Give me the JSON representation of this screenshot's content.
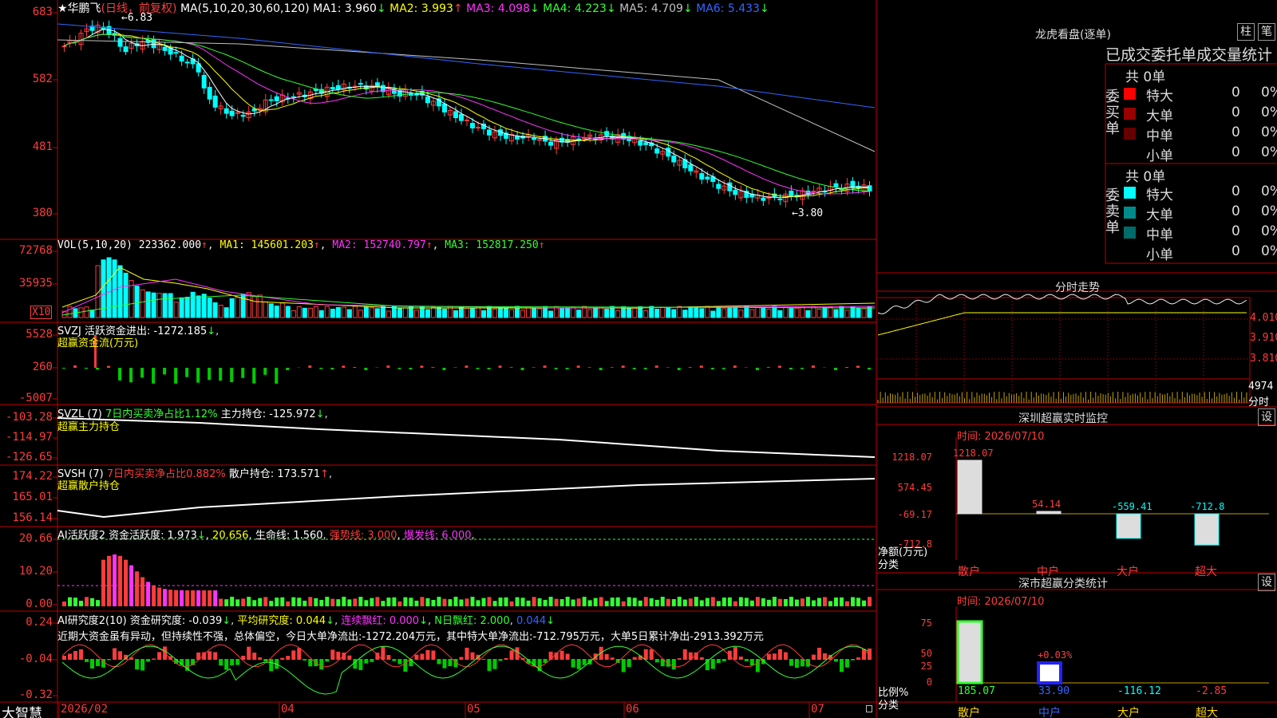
{
  "main_chart": {
    "title": "★华鹏飞",
    "period": "(日线，前复权)",
    "ma_label": "MA(5,10,20,30,60,120)",
    "ma_values": [
      {
        "label": "MA1: 3.960",
        "arrow": "↓",
        "color": "#ffffff"
      },
      {
        "label": "MA2: 3.993",
        "arrow": "↑",
        "color": "#ffff00"
      },
      {
        "label": "MA3: 4.098",
        "arrow": "↓",
        "color": "#ff33ff"
      },
      {
        "label": "MA4: 4.223",
        "arrow": "↓",
        "color": "#33ff33"
      },
      {
        "label": "MA5: 4.709",
        "arrow": "↓",
        "color": "#c0c0c0"
      },
      {
        "label": "MA6: 5.433",
        "arrow": "↓",
        "color": "#3366ff"
      }
    ],
    "y_ticks": [
      "683",
      "582",
      "481",
      "380"
    ],
    "high_label": "6.83",
    "low_label": "3.80"
  },
  "vol_panel": {
    "label": "VOL(5,10,20)",
    "value": "223362.000",
    "ma1": "MA1: 145601.203",
    "ma2": "MA2: 152740.797",
    "ma3": "MA3: 152817.250",
    "y_ticks": [
      "72768",
      "35935"
    ],
    "unit": "X10"
  },
  "svzj_panel": {
    "label": "SVZJ  活跃资金进出: -1272.185",
    "arrow": "↓",
    "subtitle": "超赢资金流(万元)",
    "y_ticks": [
      "5528",
      "260",
      "-5007"
    ]
  },
  "svzl_panel": {
    "label": "SVZL (7)",
    "ratio": "7日内买卖净占比1.12%",
    "value": "主力持仓: -125.972",
    "arrow": "↓",
    "subtitle": "超赢主力持仓",
    "y_ticks": [
      "-103.28",
      "-114.97",
      "-126.65"
    ]
  },
  "svsh_panel": {
    "label": "SVSH (7)",
    "ratio": "7日内买卖净占比0.882%",
    "value": "散户持仓: 173.571",
    "arrow": "↑",
    "subtitle": "超赢散户持仓",
    "y_ticks": [
      "174.22",
      "165.01",
      "156.14"
    ]
  },
  "ai_active_panel": {
    "label": "AI活跃度2",
    "activity": "资金活跃度: 1.973",
    "value2": "20.656",
    "life_line": "生命线: 1.560",
    "strong_line": "强势线: 3.000",
    "burst_line": "爆发线: 6.000",
    "y_ticks": [
      "20.66",
      "10.20",
      "0.00"
    ]
  },
  "ai_research_panel": {
    "label": "AI研究度2(10)",
    "research": "资金研究度: -0.039",
    "avg": "平均研究度: 0.044",
    "streak": "连续飘红: 0.000",
    "nday": "N日飘红: 2.000",
    "last": "0.044",
    "commentary": "近期大资金虽有异动，但持续性不强，总体偏空，今日大单净流出:-1272.204万元，其中特大单净流出:-712.795万元，大单5日累计净出-2913.392万元",
    "y_ticks": [
      "0.24",
      "-0.04",
      "-0.32"
    ]
  },
  "x_axis": {
    "brand": "大智慧",
    "labels": [
      "2026/02",
      "04",
      "05",
      "06",
      "07"
    ]
  },
  "dragon_tiger": {
    "title": "龙虎看盘(逐单)",
    "btn_zhu": "柱",
    "btn_bi": "笔",
    "header": "已成交委托单成交量统计",
    "buy_label": "委买单",
    "sell_label": "委卖单",
    "buy_total": "共 0单",
    "sell_total": "共 0单",
    "buy_rows": [
      {
        "name": "特大",
        "count": "0",
        "pct": "0%",
        "color": "#ff0000"
      },
      {
        "name": "大单",
        "count": "0",
        "pct": "0%",
        "color": "#990000"
      },
      {
        "name": "中单",
        "count": "0",
        "pct": "0%",
        "color": "#660000"
      },
      {
        "name": "小单",
        "count": "0",
        "pct": "0%",
        "color": ""
      }
    ],
    "sell_rows": [
      {
        "name": "特大",
        "count": "0",
        "pct": "0%",
        "color": "#00ffff"
      },
      {
        "name": "大单",
        "count": "0",
        "pct": "0%",
        "color": "#008b8b"
      },
      {
        "name": "中单",
        "count": "0",
        "pct": "0%",
        "color": "#006b6b"
      },
      {
        "name": "小单",
        "count": "0",
        "pct": "0%",
        "color": ""
      }
    ]
  },
  "intraday": {
    "title": "分时走势",
    "y_ticks": [
      "4.010",
      "3.910",
      "3.810"
    ],
    "vol_tick": "4974",
    "vol_label": "分时"
  },
  "sz_monitor": {
    "title": "深圳超赢实时监控",
    "btn": "设",
    "date": "时间: 2026/07/10",
    "y_ticks": [
      "1218.07",
      "574.45",
      "-69.17",
      "-712.8"
    ],
    "axis_label": "净额(万元)",
    "cat_label": "分类",
    "bars": [
      {
        "name": "散户",
        "value": 1218.07,
        "label": "1218.07"
      },
      {
        "name": "中户",
        "value": 54.14,
        "label": "54.14"
      },
      {
        "name": "大户",
        "value": -559.41,
        "label": "-559.41"
      },
      {
        "name": "超大",
        "value": -712.8,
        "label": "-712.8"
      }
    ]
  },
  "sz_classify": {
    "title": "深市超赢分类统计",
    "btn": "设",
    "date": "时间: 2026/07/10",
    "y_ticks": [
      "75",
      "50",
      "25",
      "0"
    ],
    "axis_label": "比例%",
    "cat_label": "分类",
    "mid_label": "+0.03%",
    "bars": [
      {
        "name": "散户",
        "value": 185.07,
        "label": "185.07"
      },
      {
        "name": "中户",
        "value": 33.9,
        "label": "33.90"
      },
      {
        "name": "大户",
        "value": -116.12,
        "label": "-116.12"
      },
      {
        "name": "超大",
        "value": -2.85,
        "label": "-2.85"
      }
    ]
  }
}
